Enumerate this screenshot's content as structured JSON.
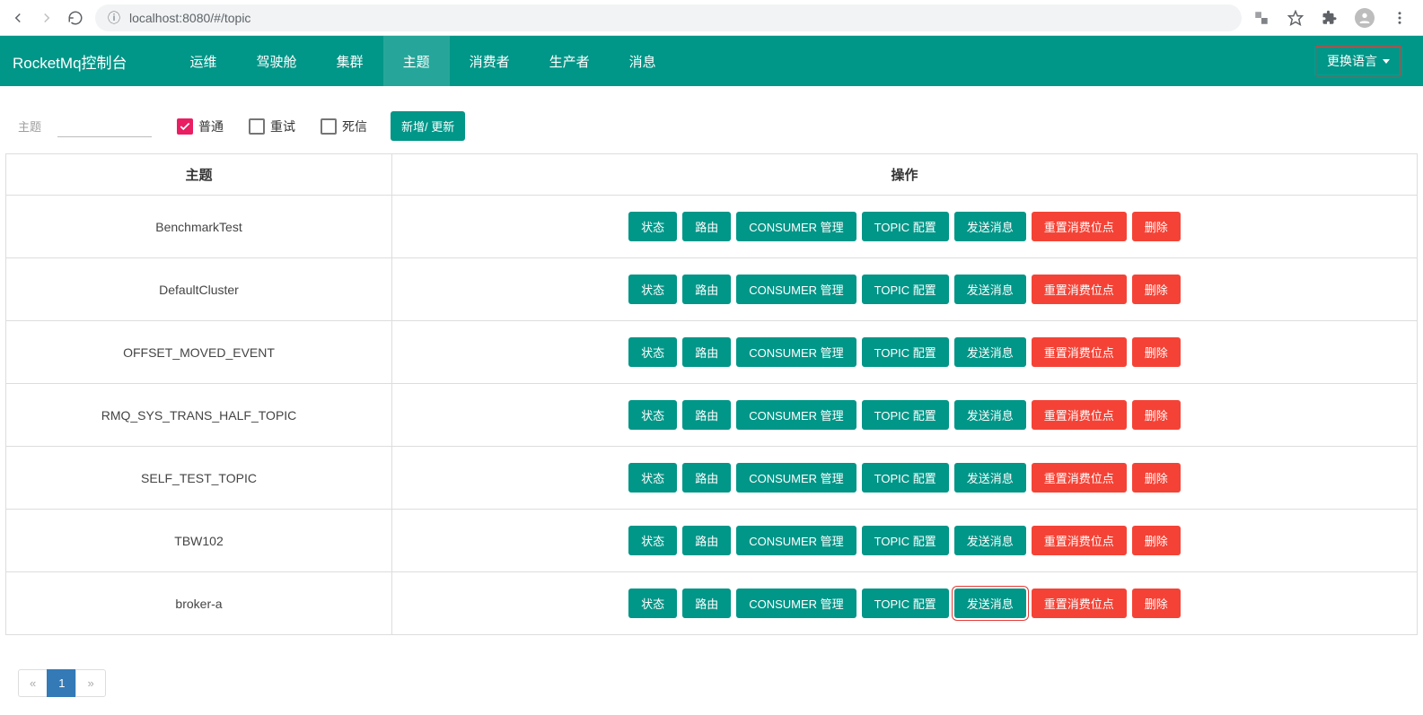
{
  "browser": {
    "url_info": "ⓘ",
    "url": "localhost:8080/#/topic"
  },
  "nav": {
    "brand": "RocketMq控制台",
    "items": [
      {
        "label": "运维",
        "active": false
      },
      {
        "label": "驾驶舱",
        "active": false
      },
      {
        "label": "集群",
        "active": false
      },
      {
        "label": "主题",
        "active": true
      },
      {
        "label": "消费者",
        "active": false
      },
      {
        "label": "生产者",
        "active": false
      },
      {
        "label": "消息",
        "active": false
      }
    ],
    "lang_label": "更换语言"
  },
  "filter": {
    "label": "主题",
    "input_value": "",
    "chk_normal": "普通",
    "chk_retry": "重试",
    "chk_dlq": "死信",
    "add_refresh": "新增/ 更新"
  },
  "table": {
    "header_topic": "主题",
    "header_ops": "操作",
    "ops": {
      "status": "状态",
      "route": "路由",
      "consumer": "CONSUMER 管理",
      "config": "TOPIC 配置",
      "send": "发送消息",
      "reset": "重置消费位点",
      "delete": "删除"
    },
    "rows": [
      {
        "topic": "BenchmarkTest",
        "highlight_send": false
      },
      {
        "topic": "DefaultCluster",
        "highlight_send": false
      },
      {
        "topic": "OFFSET_MOVED_EVENT",
        "highlight_send": false
      },
      {
        "topic": "RMQ_SYS_TRANS_HALF_TOPIC",
        "highlight_send": false
      },
      {
        "topic": "SELF_TEST_TOPIC",
        "highlight_send": false
      },
      {
        "topic": "TBW102",
        "highlight_send": false
      },
      {
        "topic": "broker-a",
        "highlight_send": true
      }
    ]
  },
  "pager": {
    "prev": "«",
    "page": "1",
    "next": "»"
  }
}
